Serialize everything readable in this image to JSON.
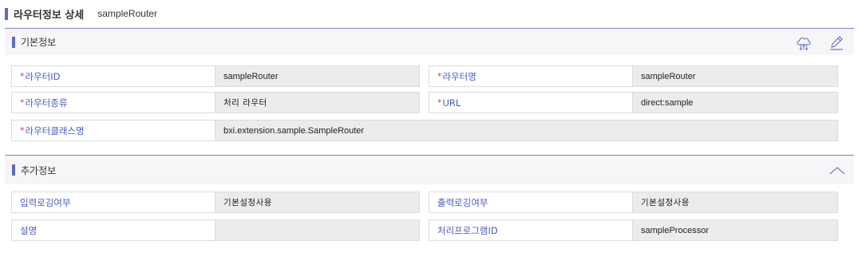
{
  "header": {
    "title": "라우터정보 상세",
    "subtitle": "sampleRouter"
  },
  "basic_section": {
    "title": "기본정보",
    "fields": {
      "router_id": {
        "label": "라우터ID",
        "value": "sampleRouter",
        "required": true
      },
      "router_name": {
        "label": "라우터명",
        "value": "sampleRouter",
        "required": true
      },
      "router_type": {
        "label": "라우터종류",
        "value": "처리 라우터",
        "required": true
      },
      "url": {
        "label": "URL",
        "value": "direct:sample",
        "required": true
      },
      "router_class": {
        "label": "라우터클래스명",
        "value": "bxi.extension.sample.SampleRouter",
        "required": true
      }
    },
    "required_mark": "*"
  },
  "extra_section": {
    "title": "추가정보",
    "fields": {
      "input_logging": {
        "label": "입력로깅여부",
        "value": "기본설정사용"
      },
      "output_logging": {
        "label": "출력로깅여부",
        "value": "기본설정사용"
      },
      "description": {
        "label": "설명",
        "value": ""
      },
      "processor_id": {
        "label": "처리프로그램ID",
        "value": "sampleProcessor"
      }
    }
  },
  "icons": {
    "cloud": "cloud-deploy-icon",
    "edit": "pencil-edit-icon",
    "collapse": "chevron-up-icon"
  },
  "colors": {
    "accent": "#5c6bc0",
    "label": "#4a5ac0",
    "required": "#e53935",
    "value_bg": "#ececec",
    "section_bg": "#f6f6f8"
  }
}
